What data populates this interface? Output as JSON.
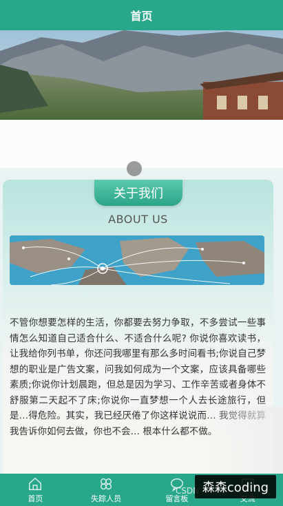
{
  "header": {
    "title": "首页"
  },
  "about": {
    "title_cn": "关于我们",
    "title_en": "ABOUT US",
    "paragraph": "不管你想要怎样的生活，你都要去努力争取，不多尝试一些事情怎么知道自己适合什么、不适合什么呢? 你说你喜欢读书，让我给你列书单，你还问我哪里有那么多时间看书;你说自己梦想的职业是广告文案，问我如何成为一个文案，应该具备哪些素质;你说你计划晨跑，但总是因为学习、工作辛苦或者身体不舒服第二天起不了床;你说你一直梦想一个人去长途旅行，但是…得危险。其实，我已经厌倦了你这样说说而… 我觉得就算我告诉你如何去做，你也不会… 根本什么都不做。"
  },
  "tabs": [
    {
      "label": "首页",
      "icon": "home-icon"
    },
    {
      "label": "失踪人员",
      "icon": "clover-icon"
    },
    {
      "label": "留言板",
      "icon": "message-icon"
    },
    {
      "label": "交流",
      "icon": "chat-icon"
    }
  ],
  "watermark": {
    "text": "森森coding",
    "csdn": "CSDN"
  }
}
